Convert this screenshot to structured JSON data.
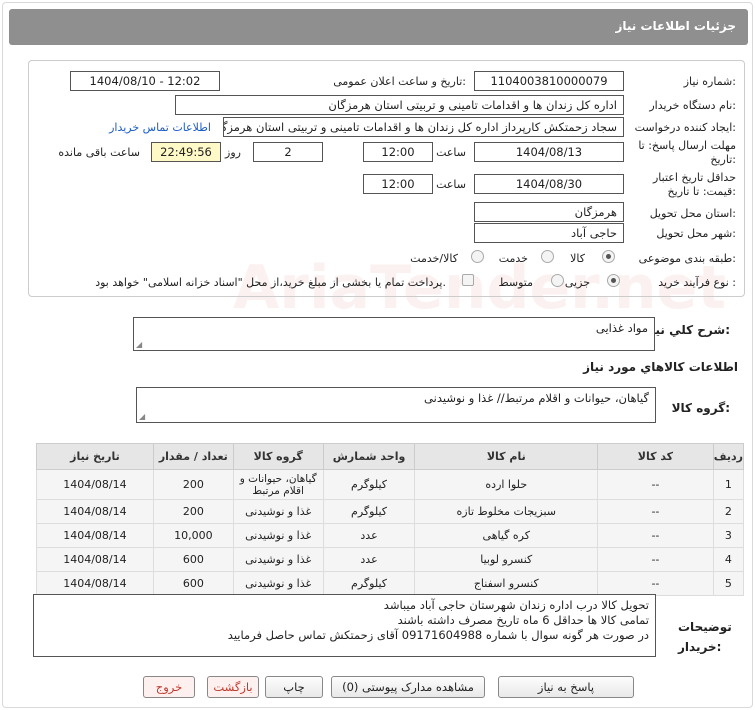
{
  "header": {
    "title": "جزئیات اطلاعات نیاز"
  },
  "form": {
    "need_number_label": "شماره نیاز:",
    "need_number": "1104003810000079",
    "announce_label": "تاریخ و ساعت اعلان عمومی:",
    "announce_value": "1404/08/10 - 12:02",
    "buyer_org_label": "نام دستگاه خریدار:",
    "buyer_org": "اداره کل زندان ها و اقدامات تامینی و تربیتی استان هرمزگان",
    "creator_label": "ایجاد کننده درخواست:",
    "creator": "سجاد زحمتکش کارپرداز اداره کل زندان ها و اقدامات تامینی و تربیتی استان هرمزگان",
    "contact_link": "اطلاعات تماس خریدار",
    "reply_deadline_label": "مهلت ارسال پاسخ: تا تاریخ:",
    "reply_date": "1404/08/13",
    "time_label": "ساعت",
    "reply_time": "12:00",
    "days": "2",
    "days_label": "روز و",
    "remaining": "22:49:56",
    "remaining_label": "ساعت باقی مانده",
    "validity_label": "حداقل تاریخ اعتبار قیمت: تا تاریخ:",
    "validity_date": "1404/08/30",
    "validity_time": "12:00",
    "province_label": "استان محل تحویل:",
    "province": "هرمزگان",
    "city_label": "شهر محل تحویل:",
    "city": "حاجی آباد",
    "category_label": "طبقه بندی موضوعی:",
    "category_options": [
      "کالا",
      "خدمت",
      "کالا/خدمت"
    ],
    "process_label": "نوع فرآیند خرید :",
    "process_options": [
      "جزیی",
      "متوسط"
    ],
    "payment_note": "پرداخت تمام یا بخشی از مبلغ خرید،از محل \"اسناد خزانه اسلامی\" خواهد بود."
  },
  "summary": {
    "label": "شرح کلي نياز:",
    "value": "مواد غذایی"
  },
  "goods_info_title": "اطلاعات کالاهاي مورد نياز",
  "group": {
    "label": "گروه کالا:",
    "value": "گیاهان، حیوانات و اقلام مرتبط// غذا و نوشیدنی"
  },
  "table": {
    "headers": [
      "ردیف",
      "کد کالا",
      "نام کالا",
      "واحد شمارش",
      "گروه کالا",
      "تعداد / مقدار",
      "تاریخ نیاز"
    ],
    "rows": [
      [
        "1",
        "--",
        "حلوا ارده",
        "کیلوگرم",
        "گیاهان، حیوانات و اقلام مرتبط",
        "200",
        "1404/08/14"
      ],
      [
        "2",
        "--",
        "سبزیجات مخلوط تازه",
        "کیلوگرم",
        "غذا و نوشیدنی",
        "200",
        "1404/08/14"
      ],
      [
        "3",
        "--",
        "کره گیاهی",
        "عدد",
        "غذا و نوشیدنی",
        "10,000",
        "1404/08/14"
      ],
      [
        "4",
        "--",
        "کنسرو لوبیا",
        "عدد",
        "غذا و نوشیدنی",
        "600",
        "1404/08/14"
      ],
      [
        "5",
        "--",
        "کنسرو اسفناج",
        "کیلوگرم",
        "غذا و نوشیدنی",
        "600",
        "1404/08/14"
      ]
    ]
  },
  "notes": {
    "label": "توضیحات خریدار:",
    "lines": [
      "تحویل کالا درب اداره زندان شهرستان حاجی آباد میباشد",
      "تمامی کالا ها حداقل 6 ماه تاریخ مصرف داشته باشند",
      "در صورت هر گونه سوال با شماره 09171604988 آقای زحمتکش تماس حاصل فرمایید"
    ]
  },
  "buttons": {
    "reply": "پاسخ به نیاز",
    "attachments": "مشاهده مدارک پیوستی (0)",
    "print": "چاپ",
    "back": "بازگشت",
    "exit": "خروج"
  },
  "watermark": "AriaTender.net"
}
